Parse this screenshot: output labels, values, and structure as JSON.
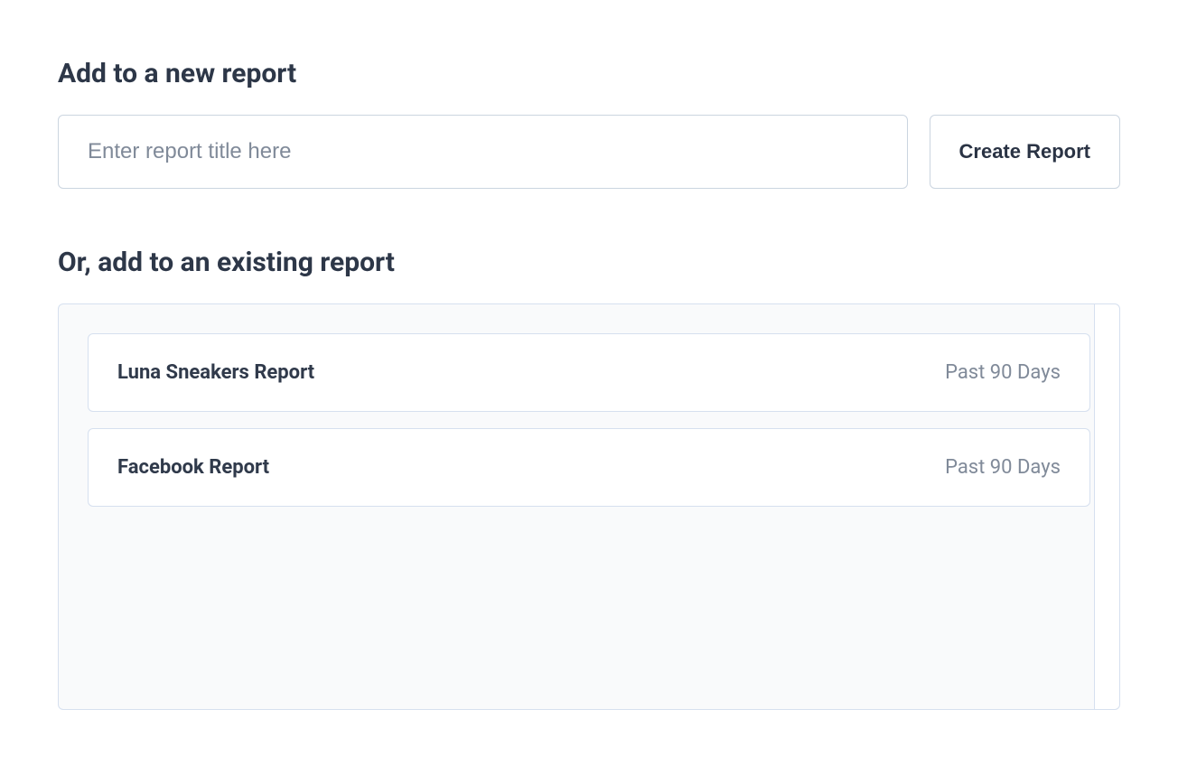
{
  "newReport": {
    "heading": "Add to a new report",
    "placeholder": "Enter report title here",
    "createButtonLabel": "Create Report"
  },
  "existingReport": {
    "heading": "Or, add to an existing report",
    "reports": [
      {
        "name": "Luna Sneakers Report",
        "period": "Past 90 Days"
      },
      {
        "name": "Facebook Report",
        "period": "Past 90 Days"
      }
    ]
  }
}
